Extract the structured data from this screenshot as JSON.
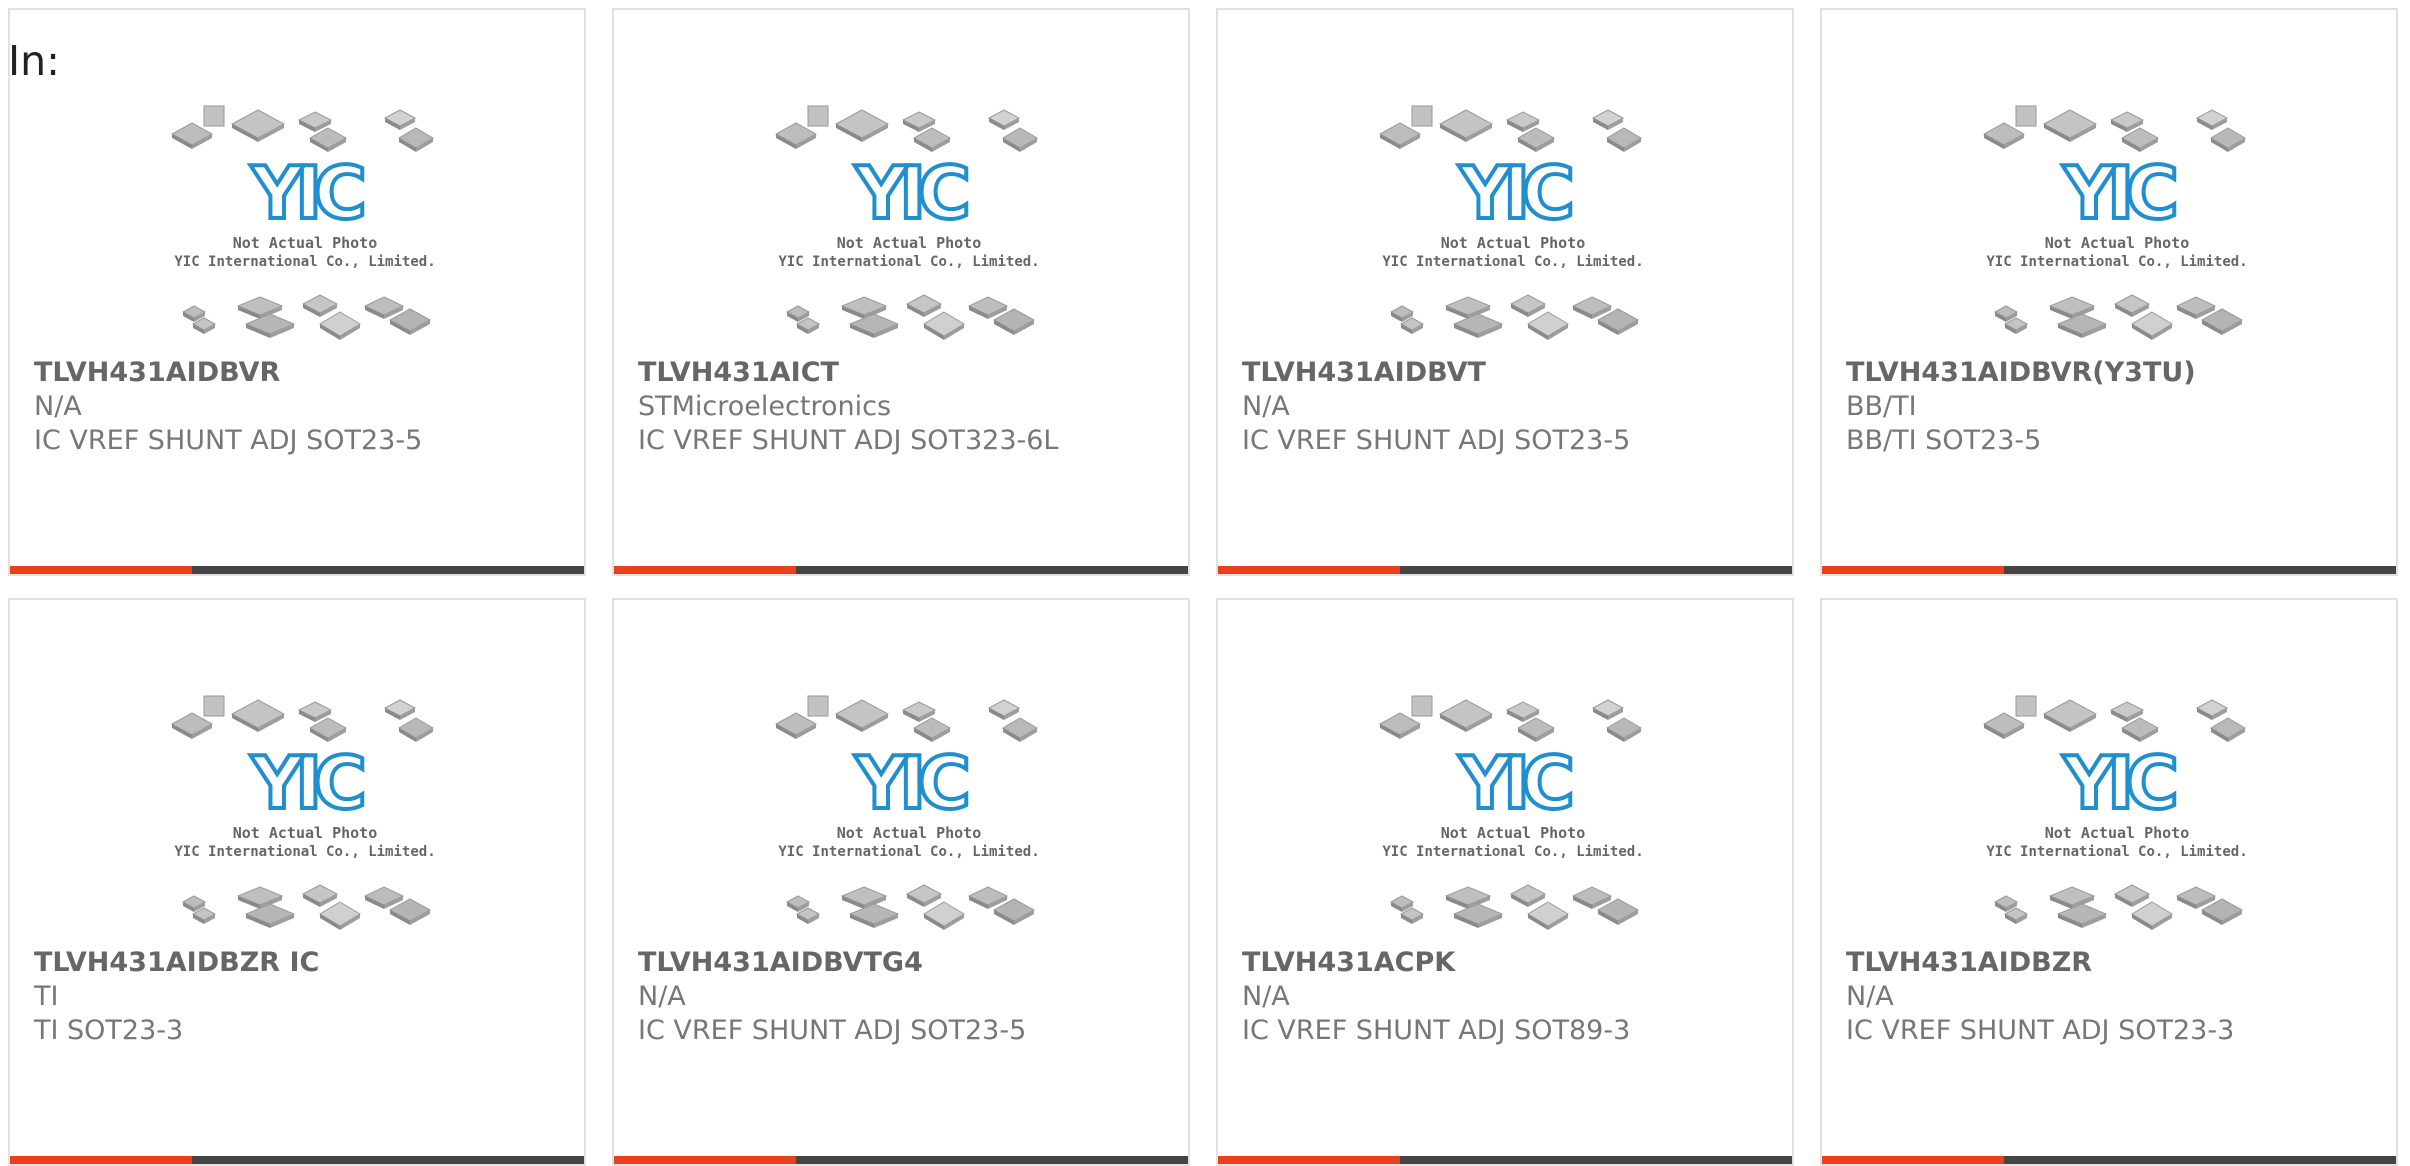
{
  "page": {
    "in_label": "In:"
  },
  "placeholder": {
    "line1": "Not Actual Photo",
    "line2": "YIC International Co., Limited.",
    "logo_text": "YIC"
  },
  "colors": {
    "accent": "#e8401c",
    "bar": "#444444",
    "card_border": "#e1e1e1",
    "logo_blue": "#1f8fd0"
  },
  "products": [
    {
      "part": "TLVH431AIDBVR",
      "maker": "N/A",
      "desc": "IC VREF SHUNT ADJ SOT23-5"
    },
    {
      "part": "TLVH431AICT",
      "maker": "STMicroelectronics",
      "desc": "IC VREF SHUNT ADJ SOT323-6L"
    },
    {
      "part": "TLVH431AIDBVT",
      "maker": "N/A",
      "desc": "IC VREF SHUNT ADJ SOT23-5"
    },
    {
      "part": "TLVH431AIDBVR(Y3TU)",
      "maker": "BB/TI",
      "desc": "BB/TI SOT23-5"
    },
    {
      "part": "TLVH431AIDBZR IC",
      "maker": "TI",
      "desc": "TI SOT23-3"
    },
    {
      "part": "TLVH431AIDBVTG4",
      "maker": "N/A",
      "desc": "IC VREF SHUNT ADJ SOT23-5"
    },
    {
      "part": "TLVH431ACPK",
      "maker": "N/A",
      "desc": "IC VREF SHUNT ADJ SOT89-3"
    },
    {
      "part": "TLVH431AIDBZR",
      "maker": "N/A",
      "desc": "IC VREF SHUNT ADJ SOT23-3"
    }
  ]
}
